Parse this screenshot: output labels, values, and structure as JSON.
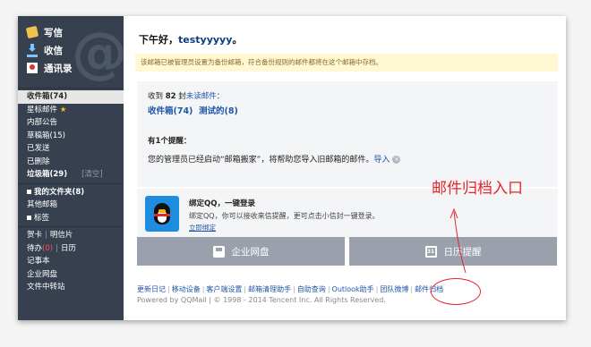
{
  "sidebar": {
    "actions": [
      {
        "label": "写信",
        "icon": "pencil-icon"
      },
      {
        "label": "收信",
        "icon": "download-arrow-icon"
      },
      {
        "label": "通讯录",
        "icon": "contacts-icon"
      }
    ],
    "mail_folders": [
      {
        "label": "收件箱(74)"
      },
      {
        "label": "星标邮件"
      },
      {
        "label": "内部公告"
      },
      {
        "label": "草稿箱(15)"
      },
      {
        "label": "已发送"
      },
      {
        "label": "已删除"
      },
      {
        "label": "垃圾箱(29)",
        "action": "[清空]"
      }
    ],
    "my_folders": {
      "label": "我的文件夹(8)",
      "items": [
        "其他邮箱"
      ]
    },
    "tags": {
      "label": "标签"
    },
    "tools": {
      "card": "贺卡",
      "postcard": "明信片",
      "todo": "待办",
      "todo_count": "(0)",
      "calendar": "日历",
      "notes": "记事本",
      "disk": "企业网盘",
      "transfer": "文件中转站"
    }
  },
  "main": {
    "greeting_prefix": "下午好，",
    "username": "testyyyyy",
    "greeting_suffix": "。",
    "notice": "该邮箱已被管理员设置为备份邮箱，符合备份规则的邮件都将在这个邮箱中存档。",
    "received_prefix": "收到 ",
    "received_count": "82",
    "received_mid": " 封",
    "unread_link": "未读邮件",
    "received_suffix": "：",
    "folder_inbox": "收件箱(74)",
    "folder_test": "测试的(8)",
    "reminder_title": "有1个提醒：",
    "reminder_text": "您的管理员已经启动“邮箱搬家”，将帮助您导入旧邮箱的邮件。",
    "import_link": "导入",
    "close_glyph": "×",
    "qq_title": "绑定QQ，一键登录",
    "qq_desc": "绑定QQ，你可以接收来信提醒，更可点击小信封一键登录。",
    "qq_link": "立即绑定",
    "btn_disk": "企业网盘",
    "btn_calendar": "日历提醒",
    "calendar_day": "31",
    "footer_links": [
      "更新日记",
      "移动设备",
      "客户端设置",
      "邮箱清理助手",
      "自助查询",
      "Outlook助手",
      "团队微博",
      "邮件归档"
    ],
    "copyright": "Powered by QQMail | © 1998 - 2014 Tencent Inc. All Rights Reserved."
  },
  "annotation": {
    "label": "邮件归档入口"
  }
}
